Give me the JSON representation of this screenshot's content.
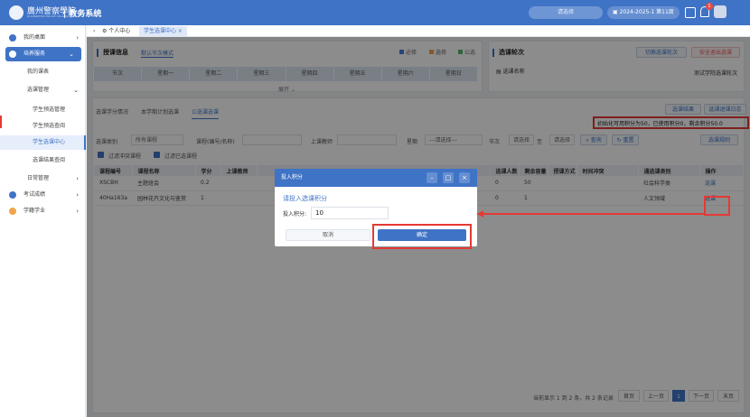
{
  "app": {
    "logo_text": "廣州警察學院",
    "logo_sub": "GUANGZHOU POLICE COLLEGE",
    "system_name": "| 教务系统",
    "search_placeholder": "请选择",
    "semester": "2024-2025-1 第11周",
    "notification_count": "1"
  },
  "sidebar": {
    "items": [
      {
        "label": "我的桌面",
        "icon": "desktop-icon"
      },
      {
        "label": "培养服务",
        "icon": "training-icon"
      },
      {
        "label": "我的课表"
      },
      {
        "label": "选课管理"
      },
      {
        "label": "学生预选管理"
      },
      {
        "label": "学生预选查阅"
      },
      {
        "label": "学生选课中心"
      },
      {
        "label": "选课结果查阅"
      },
      {
        "label": "日常管理"
      },
      {
        "label": "考试成绩",
        "icon": "exam-icon"
      },
      {
        "label": "学籍学业",
        "icon": "status-icon"
      }
    ]
  },
  "tabs": {
    "home": "个人中心",
    "current": "学生选课中心"
  },
  "schedule": {
    "title": "授课信息",
    "mode": "默认节次模式",
    "legend": [
      "必修",
      "选修",
      "公选"
    ],
    "days": [
      "节次",
      "星期一",
      "星期二",
      "星期三",
      "星期四",
      "星期五",
      "星期六",
      "星期日"
    ],
    "expand": "展开"
  },
  "round": {
    "title": "选课轮次",
    "switch_btn": "切换选课轮次",
    "exit_btn": "安全退出选课",
    "name_label": "选课名称",
    "name_value": "测试学院选课轮次"
  },
  "subtabs": [
    "选课学分情况",
    "本学期计划选课",
    "公选课选课"
  ],
  "actions": {
    "result": "选课结果",
    "log": "选课退课日志"
  },
  "credits_notice": "初始化可用积分为50，已使用积分0，剩余积分50.0",
  "filters": {
    "category_label": "选课类别",
    "category_value": "所有课程",
    "course_label": "课程(编号/名称)",
    "teacher_label": "上课教师",
    "weekday_label": "星期",
    "weekday_value": "---请选择---",
    "period_label": "节次",
    "period_from": "请选择",
    "to": "至",
    "period_to": "请选择",
    "query_btn": "查询",
    "reset_btn": "重置",
    "rules_btn": "选课规则",
    "chk_conflict": "过滤冲突课程",
    "chk_selected": "过滤已选课程"
  },
  "table": {
    "headers": [
      "课程编号",
      "课程名称",
      "学分",
      "上课教师",
      "",
      "选课人数",
      "剩余容量",
      "授课方式",
      "时间冲突",
      "通选课类别",
      "操作"
    ],
    "rows": [
      [
        "XSCBH",
        "主题班会",
        "0.2",
        "",
        "",
        "0",
        "50",
        "",
        "",
        "社会科学类",
        "选课"
      ],
      [
        "40Ha163a",
        "园林花卉文化与鉴赏",
        "1",
        "",
        "",
        "0",
        "1",
        "",
        "",
        "人文领域",
        "选课"
      ]
    ]
  },
  "pagination": {
    "summary": "当前显示 1 到 2 条，共 2 条记录",
    "first": "首页",
    "prev": "上一页",
    "page": "1",
    "next": "下一页",
    "last": "末页"
  },
  "modal": {
    "title": "投入积分",
    "subtitle": "请投入选课积分",
    "field_label": "投入积分:",
    "field_value": "10",
    "cancel": "取消",
    "confirm": "确定"
  },
  "colors": {
    "primary": "#3f73c6",
    "required": "#4e7fd6",
    "elective": "#f0a44b",
    "public": "#54b86e",
    "highlight": "#e53935"
  }
}
